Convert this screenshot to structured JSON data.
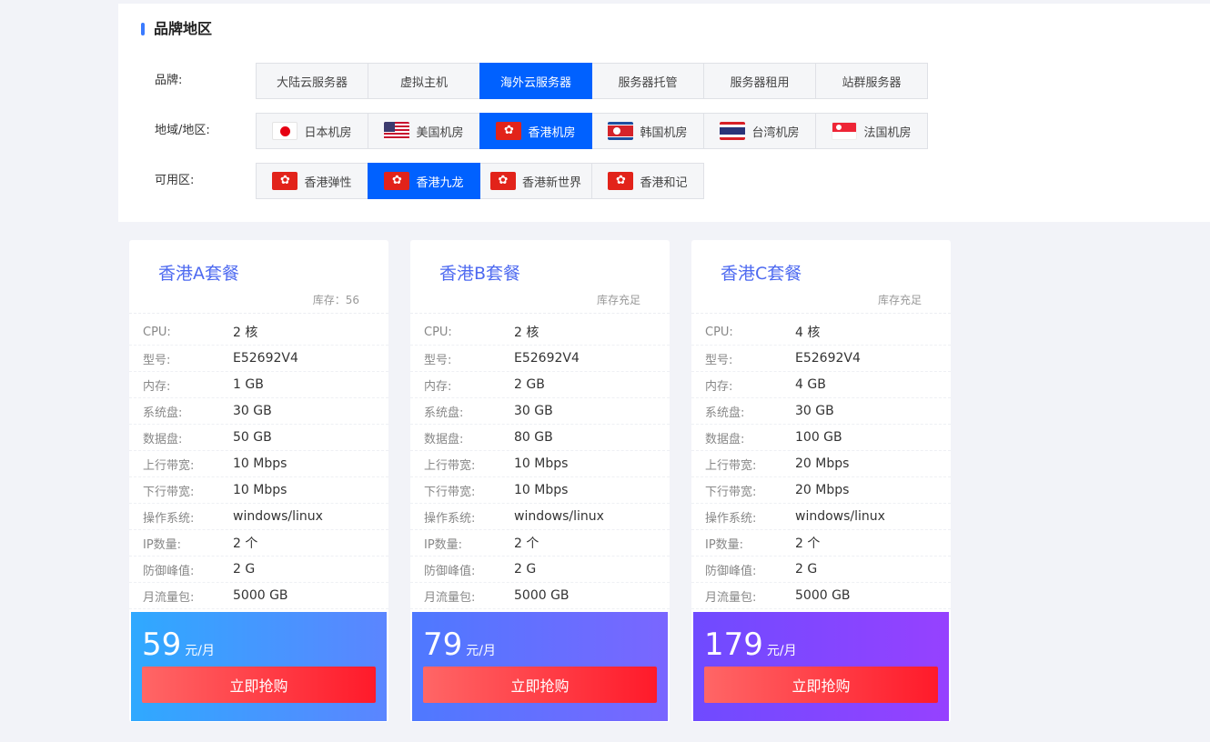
{
  "panel": {
    "title": "品牌地区",
    "rows": [
      {
        "label": "品牌:",
        "options": [
          {
            "text": "大陆云服务器"
          },
          {
            "text": "虚拟主机"
          },
          {
            "text": "海外云服务器",
            "active": true
          },
          {
            "text": "服务器托管"
          },
          {
            "text": "服务器租用"
          },
          {
            "text": "站群服务器"
          }
        ]
      },
      {
        "label": "地域/地区:",
        "options": [
          {
            "text": "日本机房",
            "flag": "flag-jp-icon"
          },
          {
            "text": "美国机房",
            "flag": "flag-us-icon"
          },
          {
            "text": "香港机房",
            "flag": "flag-hk-icon",
            "active": true
          },
          {
            "text": "韩国机房",
            "flag": "flag-kp-icon"
          },
          {
            "text": "台湾机房",
            "flag": "flag-th-icon"
          },
          {
            "text": "法国机房",
            "flag": "flag-sg-icon"
          }
        ]
      },
      {
        "label": "可用区:",
        "options": [
          {
            "text": "香港弹性",
            "flag": "flag-hk-icon"
          },
          {
            "text": "香港九龙",
            "flag": "flag-hk-icon",
            "active": true
          },
          {
            "text": "香港新世界",
            "flag": "flag-hk-icon"
          },
          {
            "text": "香港和记",
            "flag": "flag-hk-icon"
          }
        ]
      }
    ]
  },
  "plans": [
    {
      "title": "香港A套餐",
      "stock": "库存：56",
      "specs": [
        {
          "k": "CPU:",
          "v": "2 核"
        },
        {
          "k": "型号:",
          "v": "E52692V4"
        },
        {
          "k": "内存:",
          "v": "1 GB"
        },
        {
          "k": "系统盘:",
          "v": "30 GB"
        },
        {
          "k": "数据盘:",
          "v": "50 GB"
        },
        {
          "k": "上行带宽:",
          "v": "10 Mbps"
        },
        {
          "k": "下行带宽:",
          "v": "10 Mbps"
        },
        {
          "k": "操作系统:",
          "v": "windows/linux"
        },
        {
          "k": "IP数量:",
          "v": "2 个"
        },
        {
          "k": "防御峰值:",
          "v": "2 G"
        },
        {
          "k": "月流量包:",
          "v": "5000 GB"
        }
      ],
      "price": "59",
      "unit": "元/月",
      "buy": "立即抢购"
    },
    {
      "title": "香港B套餐",
      "stock": "库存充足",
      "specs": [
        {
          "k": "CPU:",
          "v": "2 核"
        },
        {
          "k": "型号:",
          "v": "E52692V4"
        },
        {
          "k": "内存:",
          "v": "2 GB"
        },
        {
          "k": "系统盘:",
          "v": "30 GB"
        },
        {
          "k": "数据盘:",
          "v": "80 GB"
        },
        {
          "k": "上行带宽:",
          "v": "10 Mbps"
        },
        {
          "k": "下行带宽:",
          "v": "10 Mbps"
        },
        {
          "k": "操作系统:",
          "v": "windows/linux"
        },
        {
          "k": "IP数量:",
          "v": "2 个"
        },
        {
          "k": "防御峰值:",
          "v": "2 G"
        },
        {
          "k": "月流量包:",
          "v": "5000 GB"
        }
      ],
      "price": "79",
      "unit": "元/月",
      "buy": "立即抢购"
    },
    {
      "title": "香港C套餐",
      "stock": "库存充足",
      "specs": [
        {
          "k": "CPU:",
          "v": "4 核"
        },
        {
          "k": "型号:",
          "v": "E52692V4"
        },
        {
          "k": "内存:",
          "v": "4 GB"
        },
        {
          "k": "系统盘:",
          "v": "30 GB"
        },
        {
          "k": "数据盘:",
          "v": "100 GB"
        },
        {
          "k": "上行带宽:",
          "v": "20 Mbps"
        },
        {
          "k": "下行带宽:",
          "v": "20 Mbps"
        },
        {
          "k": "操作系统:",
          "v": "windows/linux"
        },
        {
          "k": "IP数量:",
          "v": "2 个"
        },
        {
          "k": "防御峰值:",
          "v": "2 G"
        },
        {
          "k": "月流量包:",
          "v": "5000 GB"
        }
      ],
      "price": "179",
      "unit": "元/月",
      "buy": "立即抢购"
    }
  ]
}
